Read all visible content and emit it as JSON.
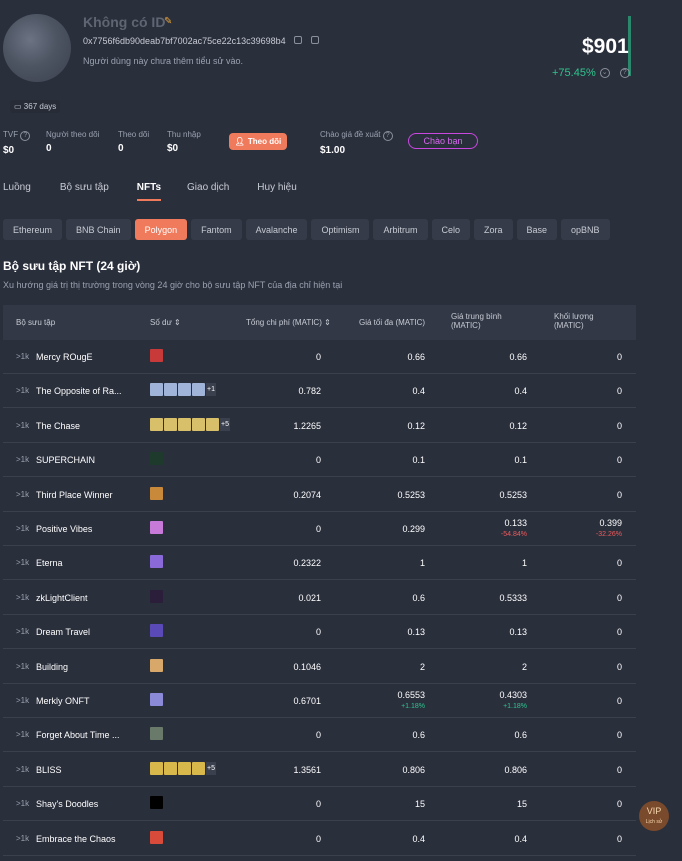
{
  "profile": {
    "name": "Không có ID",
    "address": "0x7756f6db90deab7bf7002ac75ce22c13c39698b4",
    "bio": "Người dùng này chưa thêm tiểu sử vào.",
    "days": "367 days",
    "value": "$901",
    "change": "+75.45%"
  },
  "stats": [
    {
      "label": "TVF",
      "value": "$0"
    },
    {
      "label": "Người theo dõi",
      "value": "0"
    },
    {
      "label": "Theo dõi",
      "value": "0"
    },
    {
      "label": "Thu nhập",
      "value": "$0"
    }
  ],
  "follow_label": "Theo dõi",
  "offer": {
    "label": "Chào giá đề xuất",
    "value": "$1.00",
    "button": "Chào bạn"
  },
  "tabs": [
    "Luồng",
    "Bộ sưu tập",
    "NFTs",
    "Giao dịch",
    "Huy hiệu"
  ],
  "active_tab": "NFTs",
  "chains": [
    "Ethereum",
    "BNB Chain",
    "Polygon",
    "Fantom",
    "Avalanche",
    "Optimism",
    "Arbitrum",
    "Celo",
    "Zora",
    "Base",
    "opBNB"
  ],
  "active_chain": "Polygon",
  "section": {
    "title": "Bộ sưu tập NFT (24 giờ)",
    "subtitle": "Xu hướng giá trị thị trường trong vòng 24 giờ cho bộ sưu tập NFT của địa chỉ hiện tại"
  },
  "table": {
    "headers": {
      "collection": "Bộ sưu tập",
      "balance": "Số dư",
      "total_cost": "Tổng chi phí (MATIC)",
      "max_price": "Giá tối đa (MATIC)",
      "avg_price_1": "Giá trung bình",
      "avg_price_2": "(MATIC)",
      "volume_1": "Khối lượng",
      "volume_2": "(MATIC)"
    },
    "rows": [
      {
        "rank": ">1k",
        "name": "Mercy ROugE",
        "thumbs": [
          "#c83a3a"
        ],
        "more": "",
        "cost": "0",
        "max": "0.66",
        "max_chg": "",
        "avg": "0.66",
        "avg_chg": "",
        "vol": "0",
        "vol_chg": ""
      },
      {
        "rank": ">1k",
        "name": "The Opposite of Ra...",
        "thumbs": [
          "#9fb4d8",
          "#9fb4d8",
          "#9fb4d8",
          "#9fb4d8"
        ],
        "more": "+1",
        "cost": "0.782",
        "max": "0.4",
        "max_chg": "",
        "avg": "0.4",
        "avg_chg": "",
        "vol": "0",
        "vol_chg": ""
      },
      {
        "rank": ">1k",
        "name": "The Chase",
        "thumbs": [
          "#d8c06a",
          "#d8c06a",
          "#d8c06a",
          "#d8c06a",
          "#d8c06a"
        ],
        "more": "+5",
        "cost": "1.2265",
        "max": "0.12",
        "max_chg": "",
        "avg": "0.12",
        "avg_chg": "",
        "vol": "0",
        "vol_chg": ""
      },
      {
        "rank": ">1k",
        "name": "SUPERCHAIN",
        "thumbs": [
          "#1e3a2c"
        ],
        "more": "",
        "cost": "0",
        "max": "0.1",
        "max_chg": "",
        "avg": "0.1",
        "avg_chg": "",
        "vol": "0",
        "vol_chg": ""
      },
      {
        "rank": ">1k",
        "name": "Third Place Winner",
        "thumbs": [
          "#c8893a"
        ],
        "more": "",
        "cost": "0.2074",
        "max": "0.5253",
        "max_chg": "",
        "avg": "0.5253",
        "avg_chg": "",
        "vol": "0",
        "vol_chg": ""
      },
      {
        "rank": ">1k",
        "name": "Positive Vibes",
        "thumbs": [
          "#c87ad8"
        ],
        "more": "",
        "cost": "0",
        "max": "0.299",
        "max_chg": "",
        "avg": "0.133",
        "avg_chg": "-54.84%",
        "vol": "0.399",
        "vol_chg": "-32.26%"
      },
      {
        "rank": ">1k",
        "name": "Eterna",
        "thumbs": [
          "#8a6ad8"
        ],
        "more": "",
        "cost": "0.2322",
        "max": "1",
        "max_chg": "",
        "avg": "1",
        "avg_chg": "",
        "vol": "0",
        "vol_chg": ""
      },
      {
        "rank": ">1k",
        "name": "zkLightClient",
        "thumbs": [
          "#2a1e3a"
        ],
        "more": "",
        "cost": "0.021",
        "max": "0.6",
        "max_chg": "",
        "avg": "0.5333",
        "avg_chg": "",
        "vol": "0",
        "vol_chg": ""
      },
      {
        "rank": ">1k",
        "name": "Dream Travel",
        "thumbs": [
          "#5a4ab8"
        ],
        "more": "",
        "cost": "0",
        "max": "0.13",
        "max_chg": "",
        "avg": "0.13",
        "avg_chg": "",
        "vol": "0",
        "vol_chg": ""
      },
      {
        "rank": ">1k",
        "name": "Building",
        "thumbs": [
          "#d8a86a"
        ],
        "more": "",
        "cost": "0.1046",
        "max": "2",
        "max_chg": "",
        "avg": "2",
        "avg_chg": "",
        "vol": "0",
        "vol_chg": ""
      },
      {
        "rank": ">1k",
        "name": "Merkly ONFT",
        "thumbs": [
          "#8a8ad8"
        ],
        "more": "",
        "cost": "0.6701",
        "max": "0.6553",
        "max_chg": "+1.18%",
        "avg": "0.4303",
        "avg_chg": "+1.18%",
        "vol": "0",
        "vol_chg": ""
      },
      {
        "rank": ">1k",
        "name": "Forget About Time ...",
        "thumbs": [
          "#6a7a6a"
        ],
        "more": "",
        "cost": "0",
        "max": "0.6",
        "max_chg": "",
        "avg": "0.6",
        "avg_chg": "",
        "vol": "0",
        "vol_chg": ""
      },
      {
        "rank": ">1k",
        "name": "BLISS",
        "thumbs": [
          "#d8b84a",
          "#d8b84a",
          "#d8b84a",
          "#d8b84a"
        ],
        "more": "+5",
        "cost": "1.3561",
        "max": "0.806",
        "max_chg": "",
        "avg": "0.806",
        "avg_chg": "",
        "vol": "0",
        "vol_chg": ""
      },
      {
        "rank": ">1k",
        "name": "Shay's Doodles",
        "thumbs": [
          "#000000"
        ],
        "more": "",
        "cost": "0",
        "max": "15",
        "max_chg": "",
        "avg": "15",
        "avg_chg": "",
        "vol": "0",
        "vol_chg": ""
      },
      {
        "rank": ">1k",
        "name": "Embrace the Chaos",
        "thumbs": [
          "#d84a3a"
        ],
        "more": "",
        "cost": "0",
        "max": "0.4",
        "max_chg": "",
        "avg": "0.4",
        "avg_chg": "",
        "vol": "0",
        "vol_chg": ""
      }
    ]
  },
  "vip": {
    "label": "VIP",
    "sub": "Lịch sử"
  },
  "colors": {
    "accent": "#f07a5c",
    "positive": "#2fc48d",
    "negative": "#ef5a5a",
    "offer": "#c848e0"
  }
}
